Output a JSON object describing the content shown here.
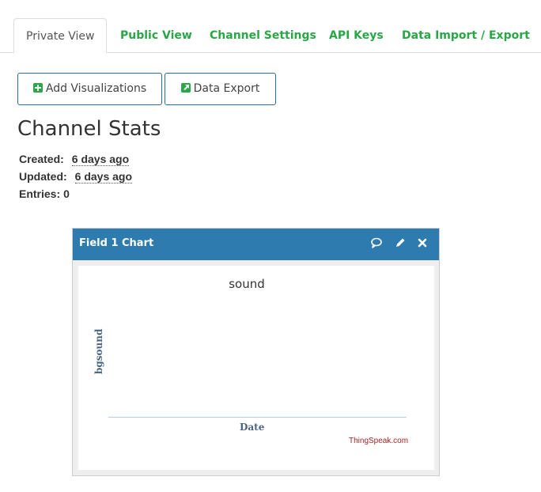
{
  "tabs": [
    {
      "label": "Private View",
      "active": true
    },
    {
      "label": "Public View",
      "active": false
    },
    {
      "label": "Channel Settings",
      "active": false
    },
    {
      "label": "API Keys",
      "active": false
    },
    {
      "label": "Data Import / Export",
      "active": false
    }
  ],
  "buttons": {
    "add_visualizations": {
      "label": "Add Visualizations",
      "icon": "plus-square-icon"
    },
    "data_export": {
      "label": "Data Export",
      "icon": "external-link-icon"
    }
  },
  "stats": {
    "title": "Channel Stats",
    "created_label": "Created:",
    "created_value": "6 days ago",
    "updated_label": "Updated:",
    "updated_value": "6 days ago",
    "entries_label": "Entries:",
    "entries_value": "0"
  },
  "widget": {
    "title": "Field 1 Chart",
    "icons": [
      "comment-icon",
      "pencil-icon",
      "close-icon"
    ]
  },
  "chart_data": {
    "type": "line",
    "title": "sound",
    "xlabel": "Date",
    "ylabel": "bgsound",
    "series": [],
    "credit": "ThingSpeak.com"
  },
  "colors": {
    "tab_link": "#28a745",
    "header_blue": "#2e7bb0",
    "button_border": "#2c6e8f",
    "axis_label": "#4a6584",
    "credit": "#aa2222"
  }
}
